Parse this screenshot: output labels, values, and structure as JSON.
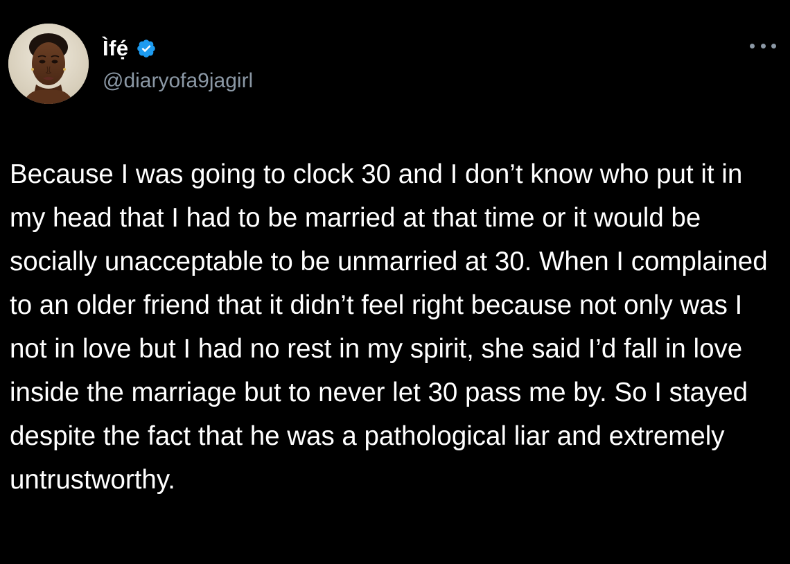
{
  "author": {
    "display_name": "Ìfẹ́",
    "handle": "@diaryofa9jagirl",
    "verified": true,
    "avatar_icon": "profile-photo",
    "verified_icon": "verified-badge-icon",
    "verified_color": "#1d9bf0"
  },
  "menu": {
    "icon": "more-options-icon"
  },
  "tweet": {
    "text": "Because I was going to clock 30 and I don’t know who put it in my head that I had to be married at that time or it would be socially unacceptable to be unmarried at 30. When I complained to an older friend that it didn’t feel right because not only was I not in love but I had no rest in my spirit, she said I’d fall in love inside the marriage but to never let 30 pass me by. So I stayed despite the fact that he was a pathological liar and extremely untrustworthy."
  },
  "colors": {
    "background": "#000000",
    "text_primary": "#ffffff",
    "text_secondary": "#8b98a5"
  }
}
